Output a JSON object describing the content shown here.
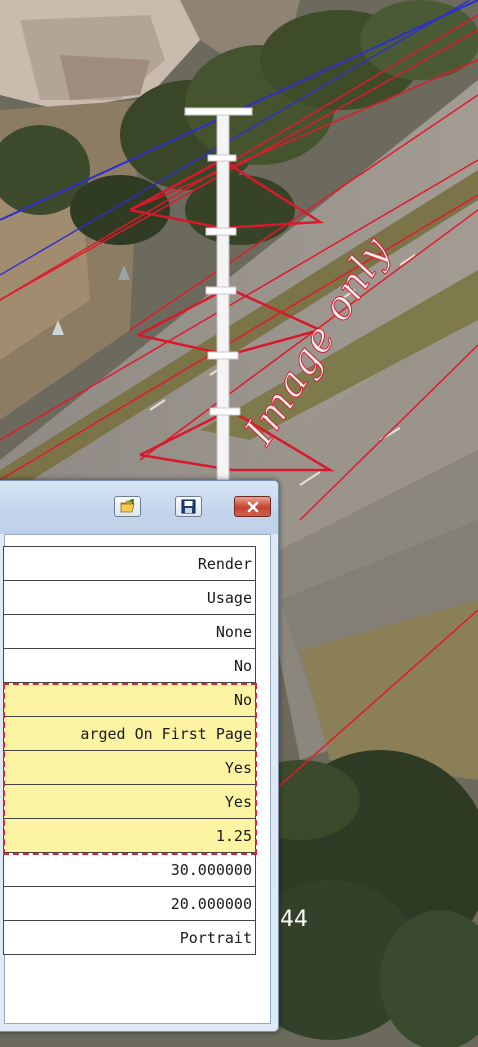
{
  "watermark": "Image only",
  "ground_label": "44",
  "dialog": {
    "toolbar_icons": [
      "open-folder-icon",
      "save-icon",
      "close-icon"
    ],
    "properties": [
      {
        "value": "Render",
        "highlighted": false
      },
      {
        "value": "Usage",
        "highlighted": false
      },
      {
        "value": "None",
        "highlighted": false
      },
      {
        "value": "No",
        "highlighted": false
      },
      {
        "value": "No",
        "highlighted": true
      },
      {
        "value": "arged On First Page",
        "highlighted": true
      },
      {
        "value": "Yes",
        "highlighted": true
      },
      {
        "value": "Yes",
        "highlighted": true
      },
      {
        "value": "1.25",
        "highlighted": true
      },
      {
        "value": "30.000000",
        "highlighted": false
      },
      {
        "value": "20.000000",
        "highlighted": false
      },
      {
        "value": "Portrait",
        "highlighted": false
      }
    ]
  },
  "colors": {
    "highlight_fill": "#fdf4a3",
    "highlight_border": "#d6263e",
    "wire_red": "#e11a2b",
    "wire_blue": "#2b2fd0"
  }
}
